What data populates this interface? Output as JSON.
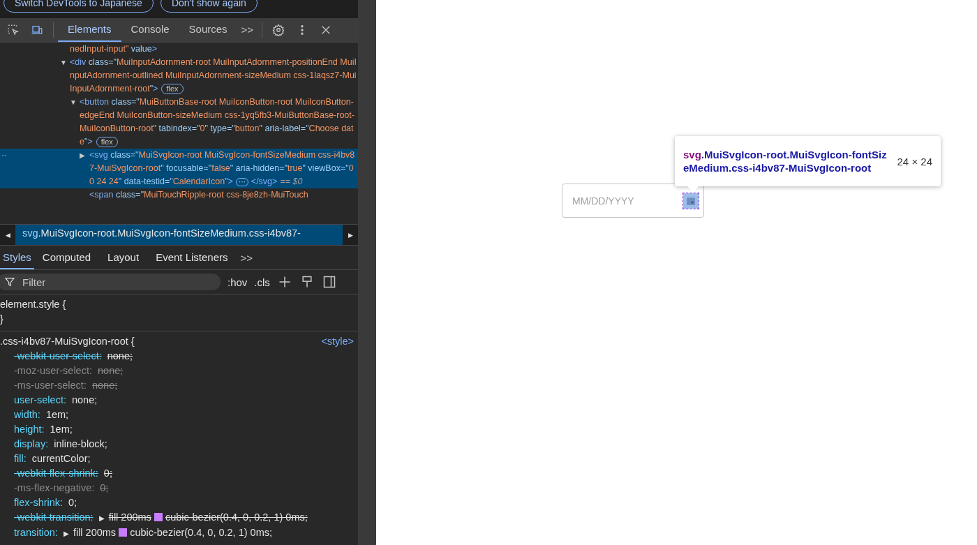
{
  "infobar": {
    "buttons": [
      "Switch DevTools to Japanese",
      "Don't show again"
    ]
  },
  "toolbar": {
    "device_mode": true,
    "tabs": [
      {
        "label": "Elements",
        "selected": true
      },
      {
        "label": "Console",
        "selected": false
      },
      {
        "label": "Sources",
        "selected": false
      }
    ],
    "more": ">>"
  },
  "dom_tree": [
    {
      "selected": false,
      "tokens": [
        {
          "kind": "value",
          "text": "nedInput-input\""
        },
        {
          "kind": "attr",
          "text": " value"
        },
        {
          "kind": "tag",
          "text": ">"
        }
      ]
    },
    {
      "arrow": "▼",
      "selected": false,
      "badge": "flex",
      "tokens": [
        {
          "kind": "tag",
          "text": "<div"
        },
        {
          "kind": "attr",
          "text": " class=\""
        },
        {
          "kind": "value",
          "text": "MuiInputAdornment-root MuiInputAdornment-positionEnd MuiInputAdornment-outlined MuiInputAdornment-sizeMedium css-1laqsz7-MuiInputAdornment-root"
        },
        {
          "kind": "attr",
          "text": "\""
        },
        {
          "kind": "tag",
          "text": ">"
        }
      ],
      "children": [
        {
          "arrow": "▼",
          "selected": false,
          "badge": "flex",
          "tokens": [
            {
              "kind": "tag",
              "text": "<button"
            },
            {
              "kind": "attr",
              "text": " class=\""
            },
            {
              "kind": "value",
              "text": "MuiButtonBase-root MuiIconButton-root MuiIconButton-edgeEnd MuiIconButton-sizeMedium css-1yq5fb3-MuiButtonBase-root-MuiIconButton-root"
            },
            {
              "kind": "attr",
              "text": "\" tabindex=\""
            },
            {
              "kind": "value",
              "text": "0"
            },
            {
              "kind": "attr",
              "text": "\" type=\""
            },
            {
              "kind": "value",
              "text": "button"
            },
            {
              "kind": "attr",
              "text": "\" aria-label=\""
            },
            {
              "kind": "value",
              "text": "Choose date"
            },
            {
              "kind": "attr",
              "text": "\""
            },
            {
              "kind": "tag",
              "text": ">"
            }
          ],
          "children": [
            {
              "arrow": "▶",
              "selected": true,
              "gutter": "··",
              "ellipsis": "···",
              "ref": "== $0",
              "tokens": [
                {
                  "kind": "tag",
                  "text": "<svg"
                },
                {
                  "kind": "attr",
                  "text": " class=\""
                },
                {
                  "kind": "value",
                  "text": "MuiSvgIcon-root MuiSvgIcon-fontSizeMedium css-i4bv87-MuiSvgIcon-root"
                },
                {
                  "kind": "attr",
                  "text": "\" focusable=\""
                },
                {
                  "kind": "value",
                  "text": "false"
                },
                {
                  "kind": "attr",
                  "text": "\" aria-hidden=\""
                },
                {
                  "kind": "value",
                  "text": "true"
                },
                {
                  "kind": "attr",
                  "text": "\" viewBox=\""
                },
                {
                  "kind": "value",
                  "text": "0 0 24 24"
                },
                {
                  "kind": "attr",
                  "text": "\" data-testid=\""
                },
                {
                  "kind": "value",
                  "text": "CalendarIcon"
                },
                {
                  "kind": "attr",
                  "text": "\""
                },
                {
                  "kind": "tag",
                  "text": ">"
                },
                {
                  "kind": "dots"
                },
                {
                  "kind": "tag",
                  "text": "</svg>"
                }
              ]
            },
            {
              "selected": false,
              "tokens": [
                {
                  "kind": "tag",
                  "text": "<span"
                },
                {
                  "kind": "attr",
                  "text": " class=\""
                },
                {
                  "kind": "value",
                  "text": "MuiTouchRipple-root css-8je8zh-MuiTouch"
                }
              ]
            }
          ]
        }
      ]
    }
  ],
  "breadcrumb": {
    "prev": "◀",
    "next": "▶",
    "parts": [
      {
        "kind": "tag",
        "text": "svg"
      },
      {
        "kind": "class",
        "text": ".MuiSvgIcon-root.MuiSvgIcon-fontSizeMedium.css-i4bv87-"
      }
    ]
  },
  "subtabs": {
    "tabs": [
      {
        "label": "Styles",
        "selected": true
      },
      {
        "label": "Computed",
        "selected": false
      },
      {
        "label": "Layout",
        "selected": false
      },
      {
        "label": "Event Listeners",
        "selected": false
      }
    ],
    "more": ">>"
  },
  "styles_toolbar": {
    "filter_placeholder": "Filter",
    "hov": ":hov",
    "cls": ".cls"
  },
  "element_style": {
    "selector": "element.style {",
    "close": "}"
  },
  "rule": {
    "selector": ".css-i4bv87-MuiSvgIcon-root {",
    "source": "<style>",
    "properties": [
      {
        "kind": "overridden",
        "name": "-webkit-user-select:",
        "value": "none;"
      },
      {
        "kind": "inactive",
        "name": "-moz-user-select:",
        "value": "none;"
      },
      {
        "kind": "inactive",
        "name": "-ms-user-select:",
        "value": "none;"
      },
      {
        "kind": "normal",
        "name": "user-select:",
        "value": "none;"
      },
      {
        "kind": "normal",
        "name": "width:",
        "value": "1em;"
      },
      {
        "kind": "normal",
        "name": "height:",
        "value": "1em;"
      },
      {
        "kind": "normal",
        "name": "display:",
        "value": "inline-block;"
      },
      {
        "kind": "normal",
        "name": "fill:",
        "value": "currentColor;"
      },
      {
        "kind": "overridden",
        "name": "-webkit-flex-shrink:",
        "value": "0;"
      },
      {
        "kind": "inactive",
        "name": "-ms-flex-negative:",
        "value": "0;"
      },
      {
        "kind": "normal",
        "name": "flex-shrink:",
        "value": "0;"
      },
      {
        "kind": "overridden",
        "name": "-webkit-transition:",
        "value": "fill 200ms",
        "easing": "cubic-bezier(0.4, 0, 0.2, 1) 0ms;"
      },
      {
        "kind": "normal",
        "name": "transition:",
        "value": "fill 200ms",
        "easing": "cubic-bezier(0.4, 0, 0.2, 1) 0ms;"
      }
    ]
  },
  "page": {
    "date_field": {
      "placeholder": "MM/DD/YYYY"
    },
    "tooltip": {
      "tag": "svg",
      "selector": ".MuiSvgIcon-root.MuiSvgIcon-fontSizeMedium.css-i4bv87-MuiSvgIcon-root",
      "size": "24 × 24"
    }
  }
}
